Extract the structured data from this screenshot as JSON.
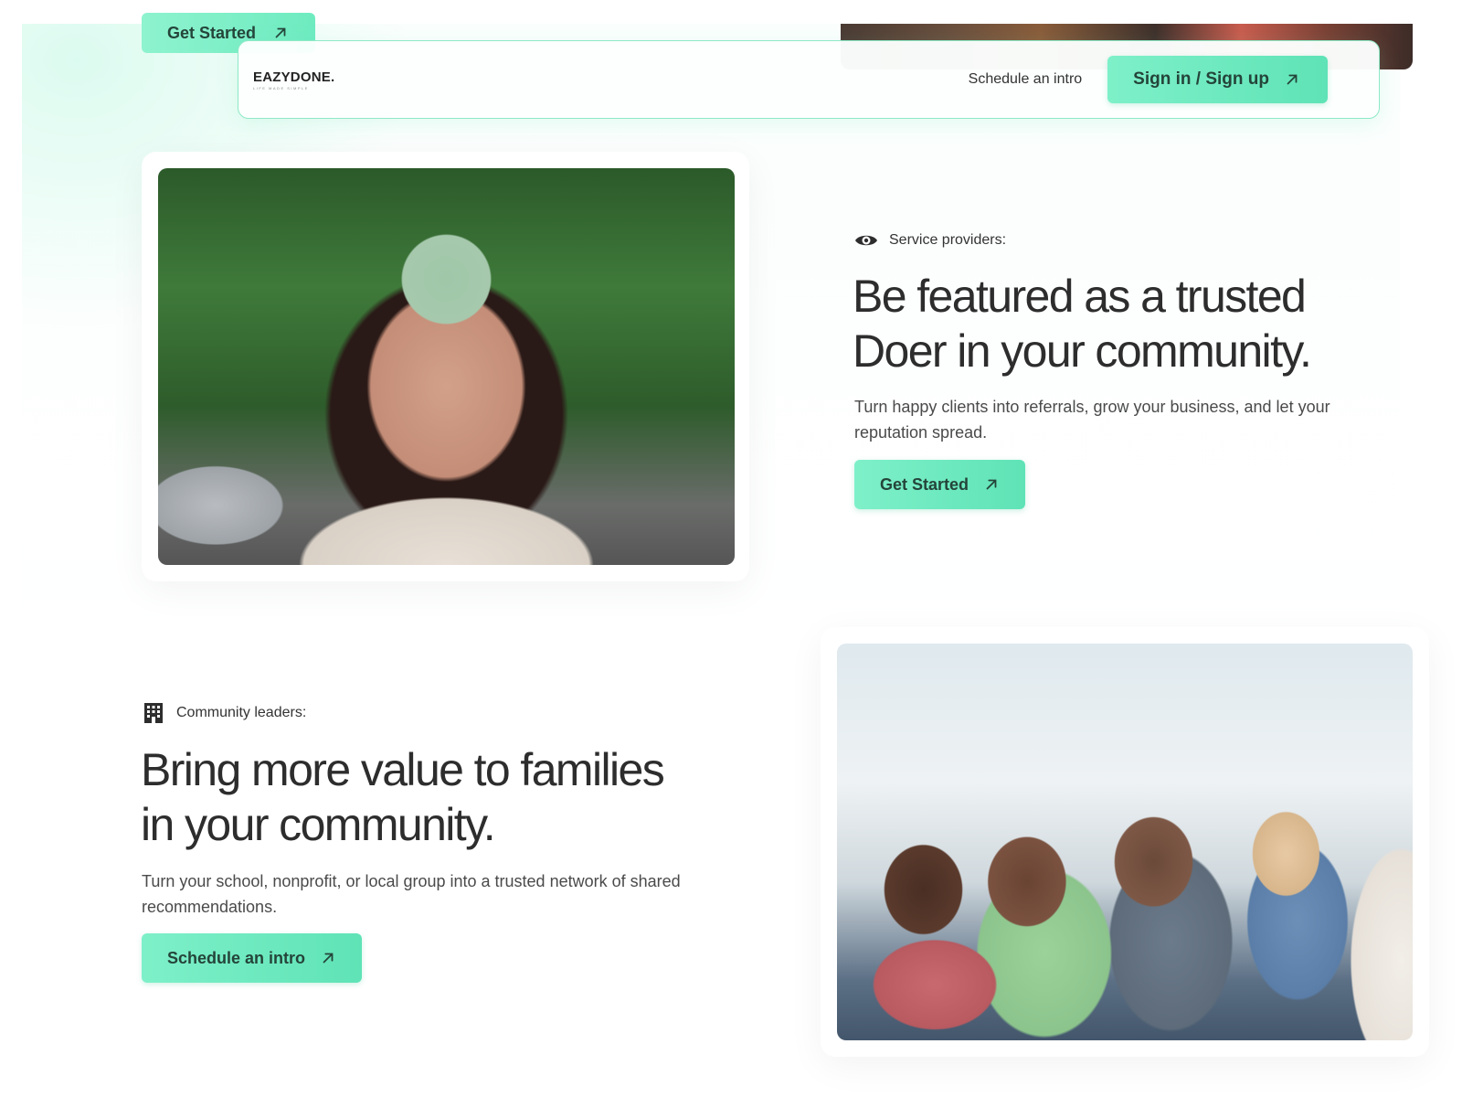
{
  "top": {
    "cta_label": "Get Started"
  },
  "nav": {
    "logo_text": "EAZYDONE.",
    "logo_tagline": "LIFE MADE SIMPLE",
    "link_label": "Schedule an intro",
    "signin_label": "Sign in / Sign up"
  },
  "providers": {
    "label": "Service providers:",
    "headline_line1": "Be featured as a trusted",
    "headline_line2": "Doer in your community.",
    "body": "Turn happy clients into referrals, grow your business, and let your reputation spread.",
    "cta_label": "Get Started"
  },
  "leaders": {
    "label": "Community leaders:",
    "headline_line1": "Bring more value to families",
    "headline_line2": "in your community.",
    "body": "Turn your school, nonprofit, or local group into a trusted network of shared recommendations.",
    "cta_label": "Schedule an intro"
  },
  "colors": {
    "accent": "#6eebc0",
    "accent_border": "#8ee9c6",
    "button_text": "#24443a",
    "headline": "#2d2d2d"
  },
  "icons": {
    "eye": "eye-icon",
    "building": "building-icon",
    "arrow": "arrow-up-right-icon"
  }
}
